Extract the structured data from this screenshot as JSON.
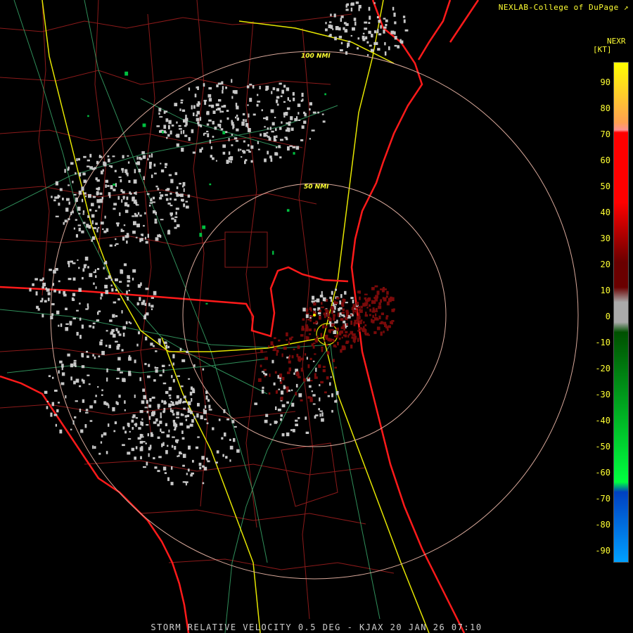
{
  "credit": "NEXLAB-College of DuPage",
  "legend": {
    "title": "NEXR",
    "unit": "[KT]",
    "ticks": [
      "90",
      "80",
      "70",
      "60",
      "50",
      "40",
      "30",
      "20",
      "10",
      "0",
      "-10",
      "-20",
      "-30",
      "-40",
      "-50",
      "-60",
      "-70",
      "-80",
      "-90"
    ],
    "colors": {
      "yellow": "#ffff00",
      "orange": "#ffa050",
      "pink": "#ff9090",
      "red": "#ff0000",
      "dark_red": "#6a0000",
      "gray": "#aaaaaa",
      "dark_green": "#005000",
      "green": "#00ff40",
      "blue": "#0040c0",
      "light_blue": "#00a0ff"
    }
  },
  "range_rings": [
    "50 NMI",
    "100 NMI"
  ],
  "footer": "STORM RELATIVE VELOCITY 0.5 DEG - KJAX 20 JAN 26 07:10",
  "icons": [
    "radar-site-icon"
  ]
}
